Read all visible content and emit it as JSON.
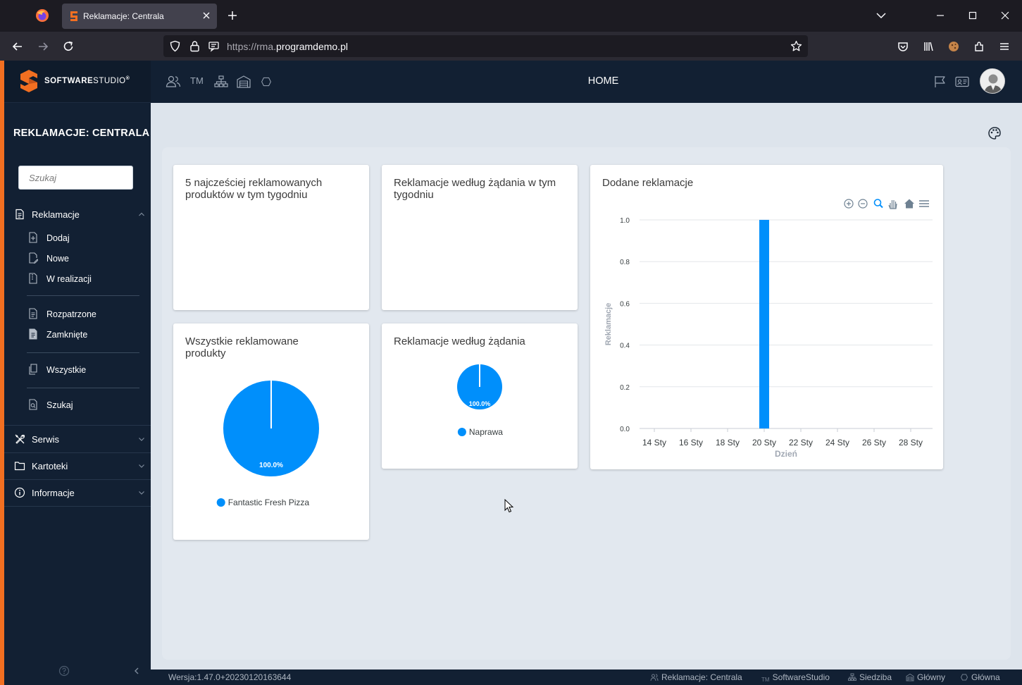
{
  "browser": {
    "tab_title": "Reklamacje: Centrala",
    "url_prefix": "https://rma.",
    "url_domain": "programdemo.pl"
  },
  "app": {
    "logo_bold": "SOFTWARE",
    "logo_thin": "STUDIO",
    "logo_reg": "®",
    "page_title": "HOME",
    "top_icons": [
      "users-icon",
      "tm-icon",
      "org-tree-icon",
      "warehouse-icon",
      "hexagon-icon"
    ],
    "top_tm": "TM"
  },
  "sidebar": {
    "title": "REKLAMACJE: CENTRALA",
    "search_placeholder": "Szukaj",
    "sections": [
      {
        "label": "Reklamacje"
      },
      {
        "label": "Serwis"
      },
      {
        "label": "Kartoteki"
      },
      {
        "label": "Informacje"
      }
    ],
    "items": [
      {
        "label": "Dodaj"
      },
      {
        "label": "Nowe"
      },
      {
        "label": "W realizacji"
      },
      {
        "label": "Rozpatrzone"
      },
      {
        "label": "Zamknięte"
      },
      {
        "label": "Wszystkie"
      },
      {
        "label": "Szukaj"
      }
    ]
  },
  "cards": {
    "top5": {
      "title": "5 najcześciej reklamowanych produktów w tym tygodniu"
    },
    "by_request_week": {
      "title": "Reklamacje według żądania w tym tygodniu"
    },
    "added": {
      "title": "Dodane reklamacje"
    },
    "all_products": {
      "title": "Wszystkie reklamowane produkty",
      "slice_label": "100.0%",
      "legend": "Fantastic Fresh Pizza"
    },
    "by_request": {
      "title": "Reklamacje według żądania",
      "slice_label": "100.0%",
      "legend": "Naprawa"
    }
  },
  "chart_data": [
    {
      "type": "bar",
      "title": "Dodane reklamacje",
      "xlabel": "Dzień",
      "ylabel": "Reklamacje",
      "x_ticks": [
        "14 Sty",
        "16 Sty",
        "18 Sty",
        "20 Sty",
        "22 Sty",
        "24 Sty",
        "26 Sty",
        "28 Sty"
      ],
      "y_ticks": [
        "0.0",
        "0.2",
        "0.4",
        "0.6",
        "0.8",
        "1.0"
      ],
      "categories": [
        "20 Sty"
      ],
      "values": [
        1
      ],
      "ylim": [
        0,
        1
      ],
      "grid": true,
      "color": "#008ffb"
    },
    {
      "type": "pie",
      "title": "Wszystkie reklamowane produkty",
      "categories": [
        "Fantastic Fresh Pizza"
      ],
      "values": [
        100
      ],
      "color": "#008ffb"
    },
    {
      "type": "pie",
      "title": "Reklamacje według żądania",
      "categories": [
        "Naprawa"
      ],
      "values": [
        100
      ],
      "color": "#008ffb"
    }
  ],
  "footer": {
    "version": "Wersja:1.47.0+20230120163644",
    "items": [
      "Reklamacje: Centrala",
      "SoftwareStudio",
      "Siedziba",
      "Główny",
      "Główna"
    ],
    "tm": "TM"
  },
  "colors": {
    "accent": "#f26f21",
    "sidebar": "#122033",
    "chart": "#008ffb"
  }
}
